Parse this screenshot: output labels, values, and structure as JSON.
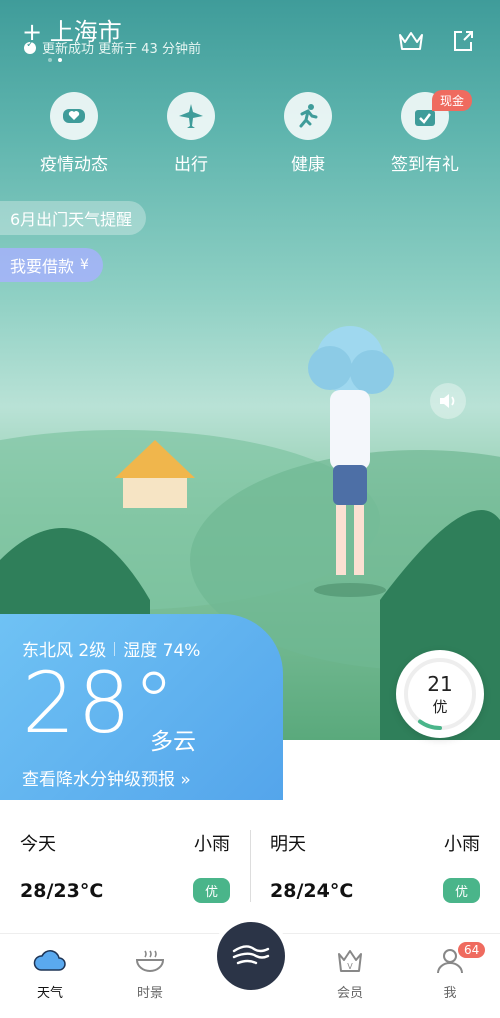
{
  "header": {
    "location": "上海市",
    "sync_status": "更新成功 更新于 43 分钟前"
  },
  "quick_actions": [
    {
      "label": "疫情动态",
      "icon": "mask-heart-icon"
    },
    {
      "label": "出行",
      "icon": "airplane-icon"
    },
    {
      "label": "健康",
      "icon": "running-person-icon"
    },
    {
      "label": "签到有礼",
      "icon": "gift-check-icon"
    }
  ],
  "cash_badge": "现金",
  "pills": {
    "alert": "6月出门天气提醒",
    "loan": "我要借款"
  },
  "weather": {
    "wind": "东北风 2级",
    "humidity": "湿度 74%",
    "temperature": "28°",
    "condition": "多云",
    "forecast_link": "查看降水分钟级预报 »"
  },
  "aqi": {
    "value": "21",
    "level": "优",
    "progress": 0.1
  },
  "days": [
    {
      "name": "今天",
      "condition": "小雨",
      "range": "28/23°C",
      "aqi": "优"
    },
    {
      "name": "明天",
      "condition": "小雨",
      "range": "28/24°C",
      "aqi": "优"
    }
  ],
  "tabs": [
    {
      "label": "天气",
      "icon": "cloud-icon"
    },
    {
      "label": "时景",
      "icon": "bowl-icon"
    },
    {
      "label": "会员",
      "icon": "vip-crown-icon"
    },
    {
      "label": "我",
      "icon": "person-icon"
    }
  ],
  "message_count": "64",
  "colors": {
    "accent": "#54a5eb",
    "good": "#4ab58a",
    "badge": "#ef6b5f"
  }
}
